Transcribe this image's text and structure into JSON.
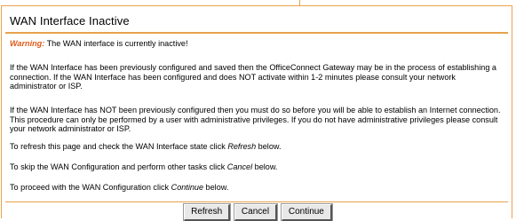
{
  "title": "WAN Interface Inactive",
  "warning": {
    "label": "Warning:",
    "text": " The WAN interface is currently inactive!"
  },
  "paragraphs": {
    "configured": "If the WAN Interface has been previously configured and saved then the OfficeConnect Gateway may be in the process of establishing a connection. If the WAN Interface has been configured and does NOT activate within 1-2 minutes please consult your network administrator or ISP.",
    "not_configured": "If the WAN Interface has NOT been previously configured then you must do so before you will be able to establish an Internet connection. This procedure can only be performed by a user with administrative privileges. If you do not have administrative privileges please consult your network administrator or ISP."
  },
  "instructions": {
    "refresh_pre": "To refresh this page and check the WAN Interface state click ",
    "refresh_word": "Refresh",
    "refresh_post": " below.",
    "skip_pre": "To skip the WAN Configuration and perform other tasks click ",
    "skip_word": "Cancel",
    "skip_post": " below.",
    "proceed_pre": "To proceed with the WAN Configuration click ",
    "proceed_word": "Continue",
    "proceed_post": " below."
  },
  "buttons": {
    "refresh": "Refresh",
    "cancel": "Cancel",
    "continue": "Continue"
  },
  "colors": {
    "accent": "#e8a24c",
    "warning": "#e05a1a"
  }
}
